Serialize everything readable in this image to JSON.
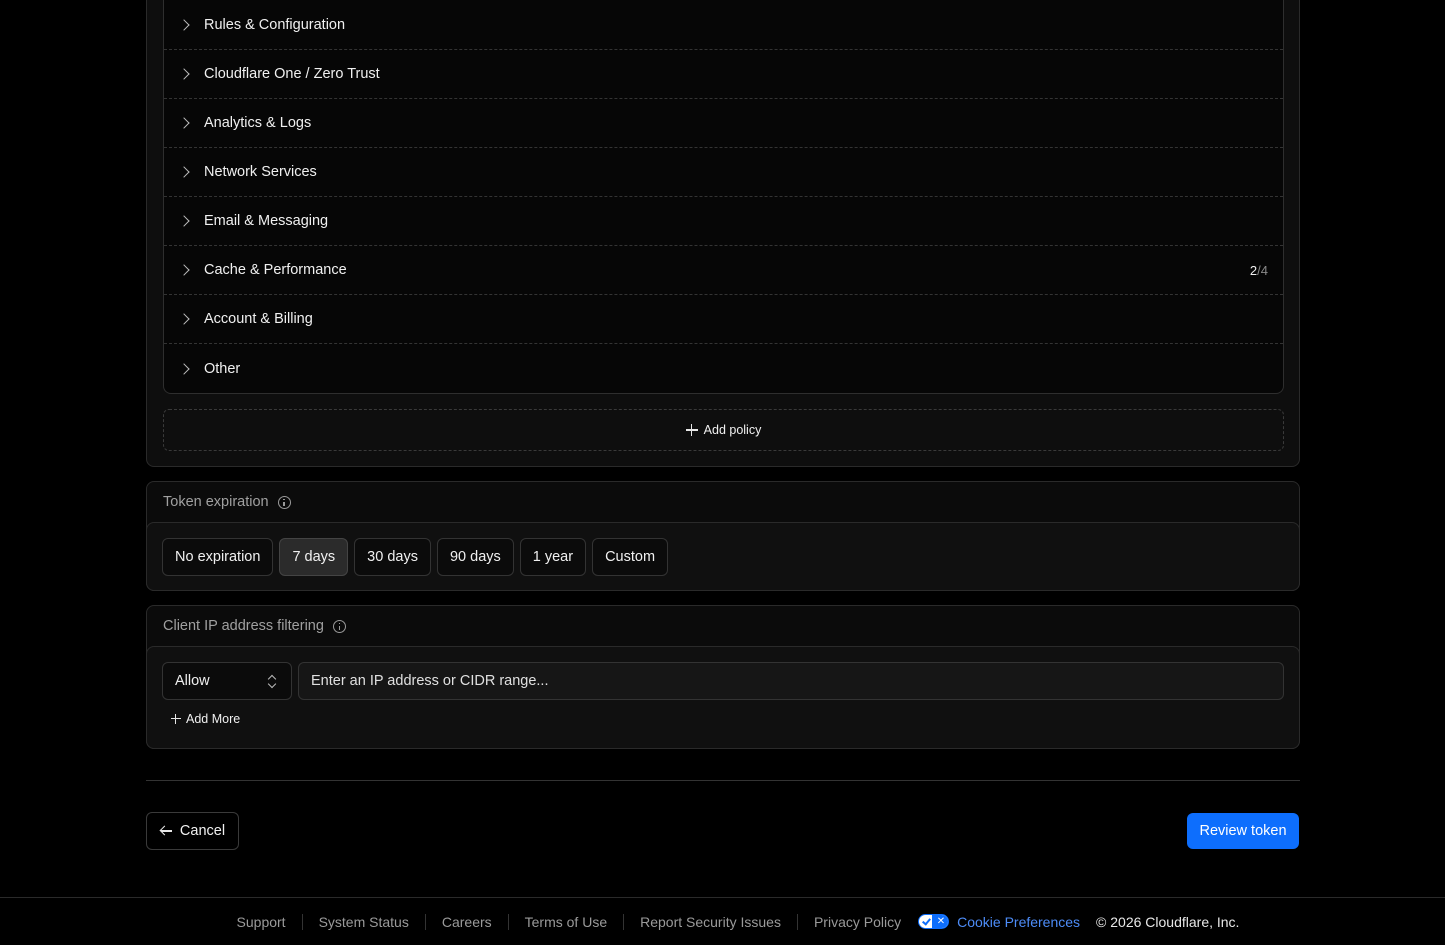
{
  "permissions": {
    "groups": [
      {
        "label": "Rules & Configuration"
      },
      {
        "label": "Cloudflare One / Zero Trust"
      },
      {
        "label": "Analytics & Logs"
      },
      {
        "label": "Network Services"
      },
      {
        "label": "Email & Messaging"
      },
      {
        "label": "Cache & Performance",
        "selected": "2",
        "separator": "/",
        "total": "4"
      },
      {
        "label": "Account & Billing"
      },
      {
        "label": "Other"
      }
    ],
    "add_policy_label": "Add policy"
  },
  "token_expiration": {
    "title": "Token expiration",
    "options": [
      "No expiration",
      "7 days",
      "30 days",
      "90 days",
      "1 year",
      "Custom"
    ],
    "selected": "7 days"
  },
  "ip_filtering": {
    "title": "Client IP address filtering",
    "mode": "Allow",
    "input_placeholder": "Enter an IP address or CIDR range...",
    "add_more_label": "Add More"
  },
  "actions": {
    "cancel_label": "Cancel",
    "review_label": "Review token",
    "primary_color": "#0d6efd"
  },
  "footer": {
    "links": [
      "Support",
      "System Status",
      "Careers",
      "Terms of Use",
      "Report Security Issues",
      "Privacy Policy"
    ],
    "cookie_label": "Cookie Preferences",
    "copyright": "© 2026 Cloudflare, Inc."
  }
}
